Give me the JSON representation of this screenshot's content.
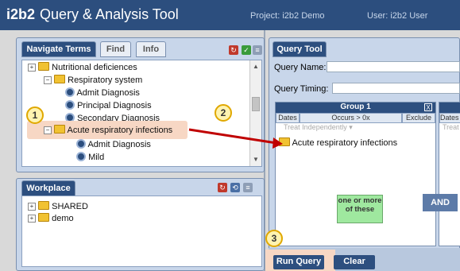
{
  "header": {
    "logo_brand": "i2b2",
    "logo_title": "Query & Analysis Tool",
    "project": "Project: i2b2 Demo",
    "user": "User: i2b2 User"
  },
  "navigate": {
    "tabs": [
      "Navigate Terms",
      "Find",
      "Info"
    ],
    "tree": [
      {
        "label": "Nutritional deficiences",
        "type": "folder",
        "expander": "+"
      },
      {
        "label": "Respiratory system",
        "type": "folder",
        "expander": "−"
      },
      {
        "label": "Admit Diagnosis",
        "type": "leaf"
      },
      {
        "label": "Principal Diagnosis",
        "type": "leaf"
      },
      {
        "label": "Secondary Diagnosis",
        "type": "leaf"
      },
      {
        "label": "Acute respiratory infections",
        "type": "folder",
        "expander": "−"
      },
      {
        "label": "Admit Diagnosis",
        "type": "leaf"
      },
      {
        "label": "Mild",
        "type": "leaf"
      }
    ]
  },
  "workplace": {
    "tab": "Workplace",
    "tree": [
      {
        "label": "SHARED",
        "type": "folder",
        "expander": "+"
      },
      {
        "label": "demo",
        "type": "folder",
        "expander": "+"
      }
    ]
  },
  "query": {
    "tab": "Query Tool",
    "name_label": "Query Name:",
    "timing_label": "Query Timing:",
    "group1": {
      "title": "Group 1",
      "close": "X",
      "dates": "Dates",
      "occurs": "Occurs > 0x",
      "exclude": "Exclude",
      "treat": "Treat Independently ▾",
      "item": "Acute respiratory infections"
    },
    "group2": {
      "dates": "Dates",
      "treat": "Treat"
    },
    "and_label": "AND",
    "hint": "one or more of these",
    "run_button": "Run Query",
    "clear_button": "Clear"
  },
  "callouts": [
    "1",
    "2",
    "3"
  ],
  "colors": {
    "header": "#2c4e7e",
    "panel_tab": "#2d4f7f",
    "highlight": "#f7d7c4",
    "arrow": "#c00000",
    "callout_fill": "#fff3b0",
    "callout_border": "#e0a800",
    "hint_bg": "#9fe89f"
  }
}
